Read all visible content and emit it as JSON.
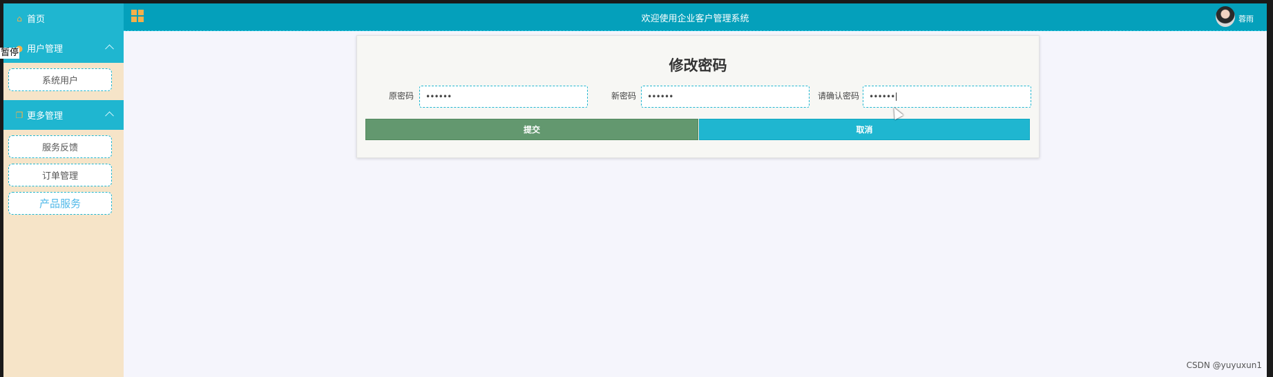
{
  "overlay_text": "暂停",
  "sidebar": {
    "home_label": "首页",
    "groups": [
      {
        "label": "用户管理",
        "items": [
          {
            "label": "系统用户"
          }
        ]
      },
      {
        "label": "更多管理",
        "items": [
          {
            "label": "服务反馈"
          },
          {
            "label": "订单管理"
          },
          {
            "label": "产品服务",
            "active": true
          }
        ]
      }
    ]
  },
  "header": {
    "title": "欢迎使用企业客户管理系统",
    "username": "蓉雨"
  },
  "form": {
    "title": "修改密码",
    "old_password_label": "原密码",
    "old_password_value": "••••••",
    "new_password_label": "新密码",
    "new_password_value": "••••••",
    "confirm_password_label": "请确认密码",
    "confirm_password_value": "••••••",
    "submit_label": "提交",
    "cancel_label": "取消"
  },
  "watermark": "CSDN @yuyuxun1",
  "colors": {
    "accent": "#1fb6d0",
    "header": "#04a0bb",
    "sidebar_bg": "#f6e4c8",
    "submit": "#63986f"
  }
}
